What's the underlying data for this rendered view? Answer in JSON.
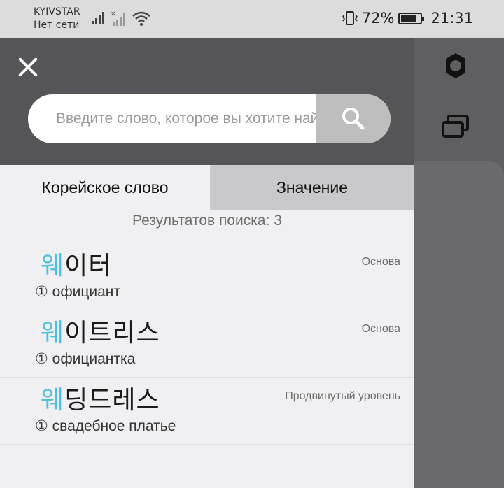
{
  "status_bar": {
    "carrier": "KYIVSTAR",
    "network_status": "Нет сети",
    "battery_percent": "72%",
    "battery_level": 0.72,
    "time": "21:31"
  },
  "search": {
    "placeholder": "Введите слово, которое вы хотите найти"
  },
  "tabs": [
    {
      "label": "Корейское слово",
      "active": true
    },
    {
      "label": "Значение",
      "active": false
    }
  ],
  "results": {
    "count_text": "Результатов поиска: 3",
    "items": [
      {
        "highlight": "웨",
        "rest": "이터",
        "level": "Основа",
        "meaning": "① официант"
      },
      {
        "highlight": "웨",
        "rest": "이트리스",
        "level": "Основа",
        "meaning": "① официантка"
      },
      {
        "highlight": "웨",
        "rest": "딩드레스",
        "level": "Продвинутый уровень",
        "meaning": "① свадебное платье"
      }
    ]
  },
  "colors": {
    "highlight": "#4dc0e6",
    "header_bg": "#555557",
    "search_button_bg": "#bdbdbd",
    "inactive_tab_bg": "#c9c9cb"
  },
  "icons": [
    "signal-icon",
    "signal-off-icon",
    "wifi-icon",
    "vibrate-icon",
    "battery-icon",
    "close-icon",
    "search-icon",
    "settings-icon",
    "windows-icon"
  ]
}
